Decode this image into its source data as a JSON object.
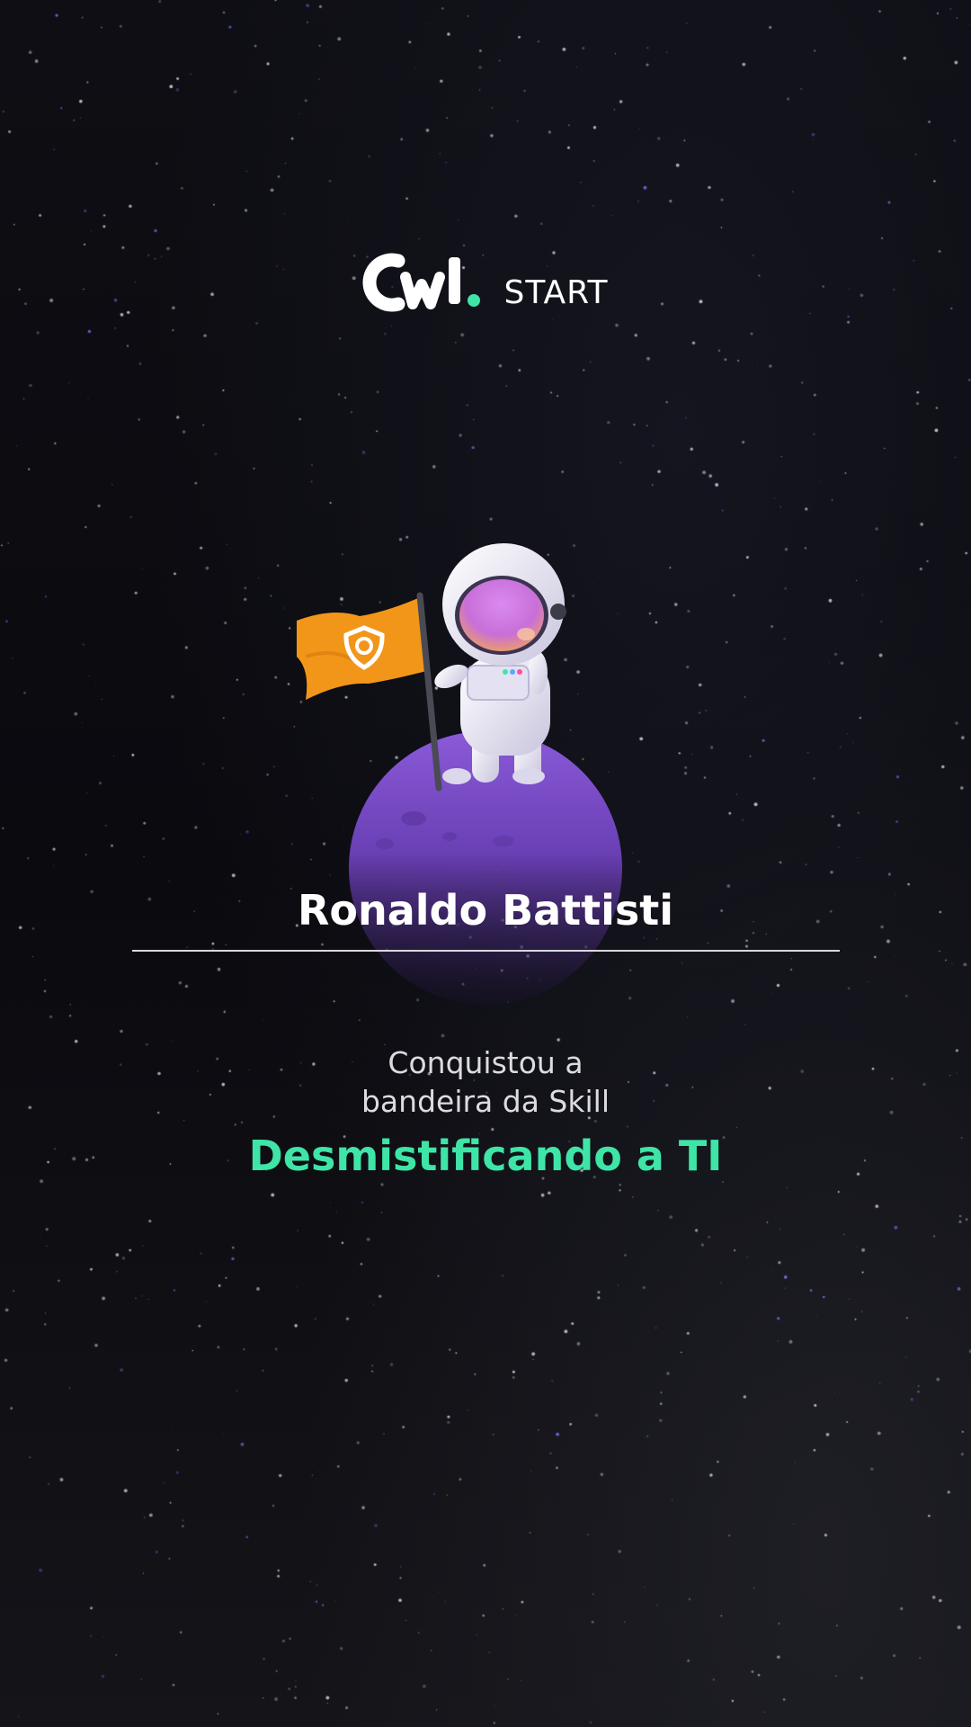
{
  "brand": {
    "logo_text": "START",
    "logo_mark_label": "CWI",
    "accent_color": "#3ee5a6"
  },
  "certificate": {
    "recipient_name": "Ronaldo Battisti",
    "message_line_1": "Conquistou a",
    "message_line_2": "bandeira da Skill",
    "skill_name": "Desmistificando a TI"
  },
  "illustration": {
    "icons": [
      "astronaut-icon",
      "flag-icon",
      "shield-icon",
      "planet-icon",
      "star-field"
    ],
    "colors": {
      "flag": "#f2961a",
      "planet": "#7a4fc9",
      "visor": "#e58cd8",
      "suit": "#eceaf4"
    }
  }
}
